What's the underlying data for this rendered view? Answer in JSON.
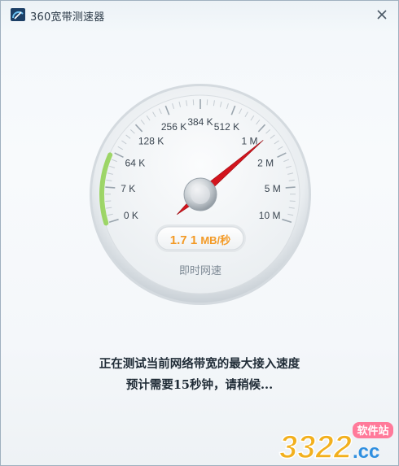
{
  "window": {
    "title": "360宽带测速器"
  },
  "gauge": {
    "scale_labels": [
      "0 K",
      "7 K",
      "64 K",
      "128 K",
      "256 K",
      "384 K",
      "512 K",
      "1 M",
      "2 M",
      "5 M",
      "10 M"
    ],
    "speed_value": "1.7 1",
    "speed_unit": "MB/秒",
    "caption": "即时网速",
    "needle_label_index": 7.3,
    "accent_color": "#f39a26",
    "needle_color": "#d3141d",
    "arc_color": "#8fd14f"
  },
  "status": {
    "line1": "正在测试当前网络带宽的最大接入速度",
    "line2": "预计需要15秒钟，请稍候..."
  },
  "watermark": {
    "number": "3322",
    "domain": ".cc",
    "badge": "软件站"
  }
}
